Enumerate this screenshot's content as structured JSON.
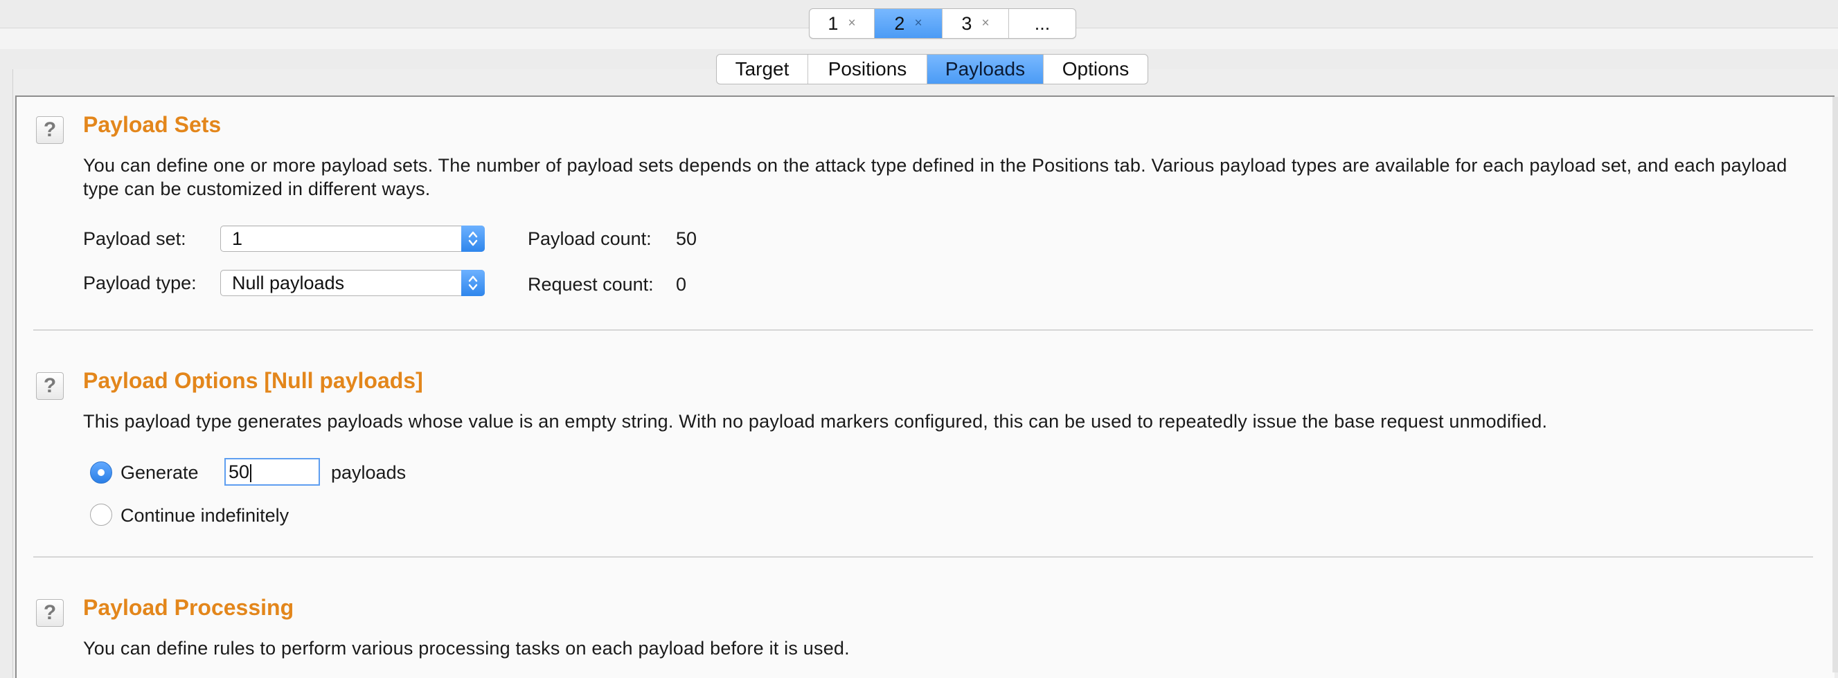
{
  "attack_tabs": [
    {
      "label": "1",
      "close": "×"
    },
    {
      "label": "2",
      "close": "×"
    },
    {
      "label": "3",
      "close": "×"
    },
    {
      "label": "..."
    }
  ],
  "sub_tabs": [
    "Target",
    "Positions",
    "Payloads",
    "Options"
  ],
  "active_sub_tab": "Payloads",
  "payload_sets": {
    "help": "?",
    "title": "Payload Sets",
    "description": "You can define one or more payload sets. The number of payload sets depends on the attack type defined in the Positions tab. Various payload types are available for each payload set, and each payload type can be customized in different ways.",
    "set_label": "Payload set:",
    "set_value": "1",
    "type_label": "Payload type:",
    "type_value": "Null payloads",
    "payload_count_label": "Payload count:",
    "payload_count": "50",
    "request_count_label": "Request count:",
    "request_count": "0"
  },
  "payload_options": {
    "help": "?",
    "title": "Payload Options [Null payloads]",
    "description": "This payload type generates payloads whose value is an empty string. With no payload markers configured, this can be used to repeatedly issue the base request unmodified.",
    "generate_label": "Generate",
    "generate_value": "50",
    "payloads_suffix": "payloads",
    "continue_label": "Continue indefinitely",
    "selected": "generate"
  },
  "payload_processing": {
    "help": "?",
    "title": "Payload Processing",
    "description": "You can define rules to perform various processing tasks on each payload before it is used."
  },
  "colors": {
    "accent": "#4b9bf5",
    "section_title": "#e3861b"
  }
}
